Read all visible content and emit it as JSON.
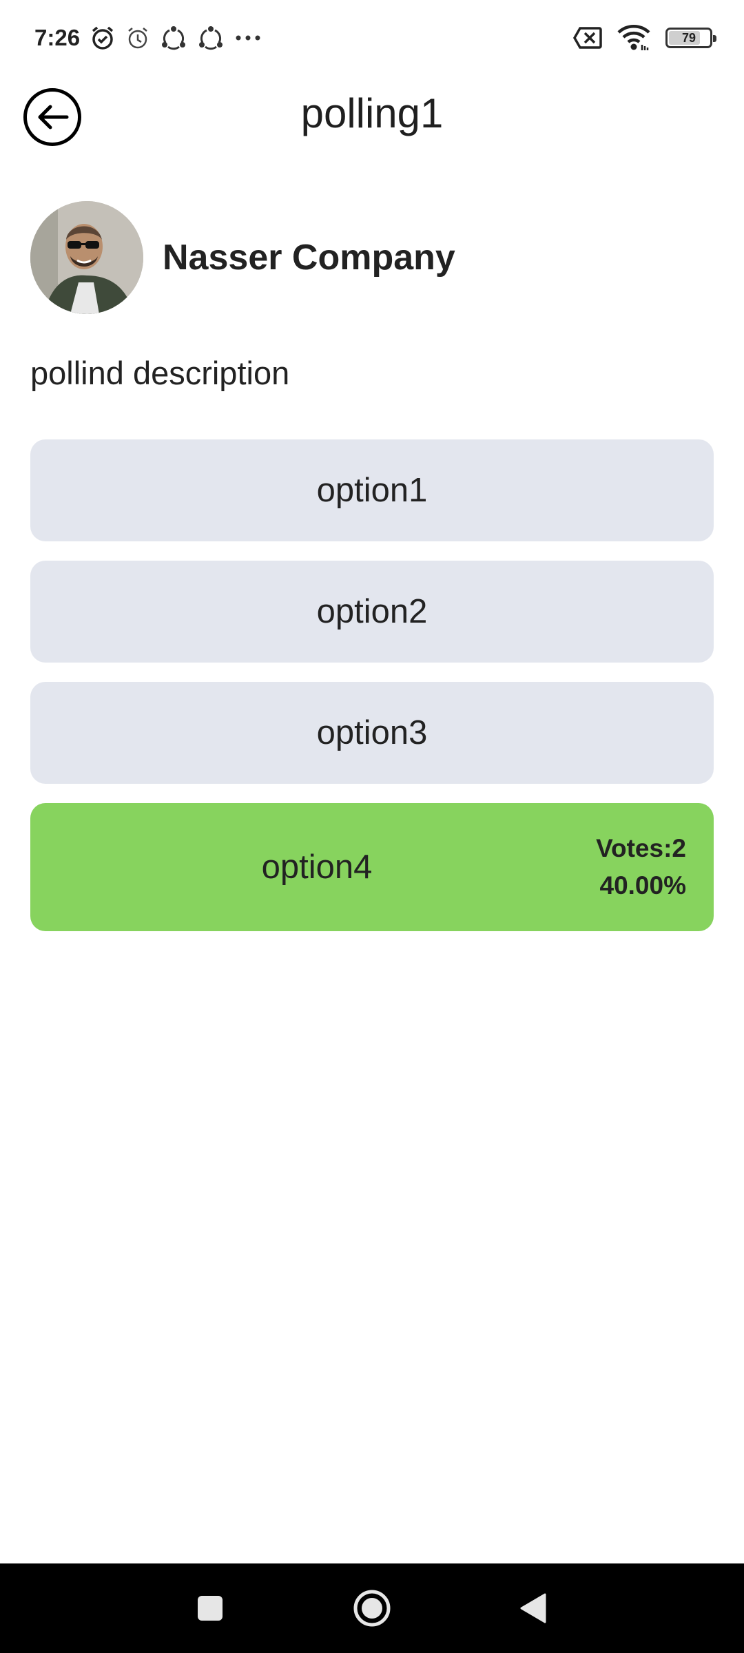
{
  "status_bar": {
    "time": "7:26",
    "icons": [
      "alarm-clock-icon",
      "alarm-clock-outline-icon",
      "sync-icon",
      "sync-icon",
      "more-dots-icon"
    ],
    "battery_level": "79",
    "battery_fraction": 0.79
  },
  "header": {
    "title": "polling1",
    "back_icon": "back-arrow-icon"
  },
  "poll": {
    "author": "Nasser Company",
    "description": "pollind description",
    "options": [
      {
        "label": "option1"
      },
      {
        "label": "option2"
      },
      {
        "label": "option3"
      },
      {
        "label": "option4",
        "votes": "Votes:2",
        "percentage": "40.00%",
        "selected": true
      }
    ]
  },
  "colors": {
    "option_bg": "#e3e6ee",
    "selected_bg": "#87d35e",
    "nav_bar_bg": "#000000"
  },
  "nav_bar": {
    "icons": [
      "recent-apps-icon",
      "home-icon",
      "back-triangle-icon"
    ]
  }
}
